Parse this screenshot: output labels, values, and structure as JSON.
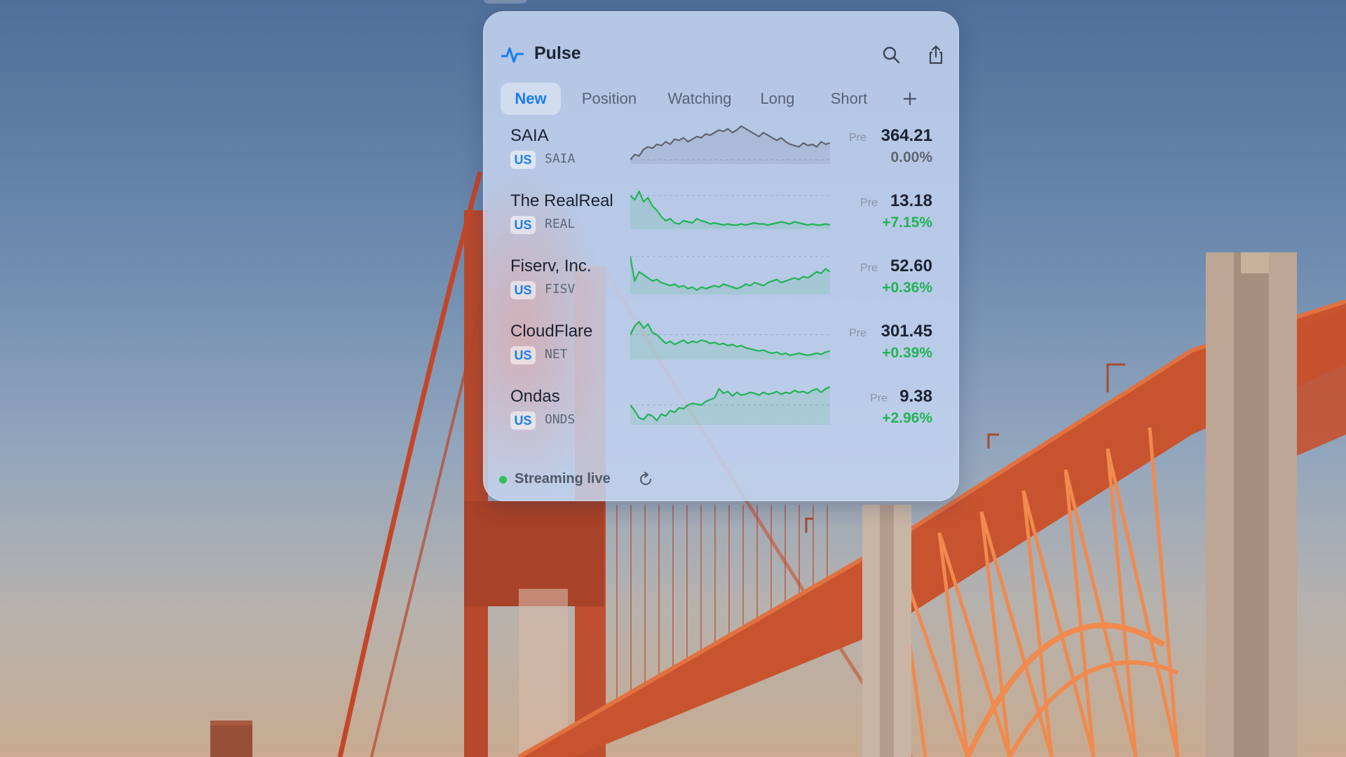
{
  "app": {
    "title": "Pulse",
    "icon": "pulse-icon"
  },
  "header": {
    "actions": [
      {
        "name": "search-icon"
      },
      {
        "name": "share-icon"
      },
      {
        "name": "more-icon"
      }
    ]
  },
  "tabs": [
    {
      "label": "New",
      "active": true
    },
    {
      "label": "Position",
      "active": false
    },
    {
      "label": "Watching",
      "active": false
    },
    {
      "label": "Long",
      "active": false
    },
    {
      "label": "Short",
      "active": false
    }
  ],
  "add_tab_icon": "plus-icon",
  "stocks": [
    {
      "name": "SAIA",
      "market": "US",
      "ticker": "SAIA",
      "session": "Pre",
      "price": "364.21",
      "change": "0.00%",
      "trend": "flat",
      "spark": [
        10,
        14,
        13,
        18,
        20,
        19,
        22,
        21,
        24,
        22,
        26,
        25,
        27,
        24,
        26,
        28,
        27,
        30,
        29,
        31,
        33,
        32,
        34,
        31,
        33,
        36,
        34,
        32,
        30,
        28,
        31,
        29,
        27,
        25,
        27,
        24,
        22,
        21,
        20,
        23,
        21,
        22,
        20,
        24,
        22,
        23
      ]
    },
    {
      "name": "The RealReal",
      "market": "US",
      "ticker": "REAL",
      "session": "Pre",
      "price": "13.18",
      "change": "+7.15%",
      "trend": "up",
      "spark": [
        30,
        26,
        34,
        24,
        28,
        20,
        16,
        10,
        6,
        8,
        4,
        3,
        6,
        5,
        4,
        8,
        6,
        5,
        3,
        4,
        3,
        2,
        3,
        2,
        2,
        3,
        2,
        3,
        4,
        3,
        3,
        2,
        3,
        4,
        5,
        4,
        3,
        5,
        4,
        3,
        2,
        3,
        2,
        2,
        3,
        2
      ]
    },
    {
      "name": "Fiserv, Inc.",
      "market": "US",
      "ticker": "FISV",
      "session": "Pre",
      "price": "52.60",
      "change": "+0.36%",
      "trend": "up",
      "spark": [
        32,
        16,
        22,
        20,
        18,
        16,
        17,
        15,
        14,
        13,
        14,
        12,
        13,
        11,
        12,
        10,
        12,
        11,
        12,
        13,
        12,
        14,
        13,
        12,
        11,
        12,
        14,
        13,
        15,
        14,
        13,
        15,
        16,
        17,
        15,
        16,
        17,
        18,
        17,
        19,
        18,
        20,
        22,
        21,
        24,
        22
      ]
    },
    {
      "name": "CloudFlare",
      "market": "US",
      "ticker": "NET",
      "session": "Pre",
      "price": "301.45",
      "change": "+0.39%",
      "trend": "up",
      "spark": [
        22,
        30,
        34,
        28,
        32,
        24,
        22,
        18,
        14,
        16,
        13,
        15,
        17,
        14,
        16,
        15,
        17,
        16,
        14,
        15,
        13,
        14,
        12,
        13,
        11,
        12,
        10,
        9,
        8,
        7,
        8,
        6,
        5,
        6,
        4,
        5,
        3,
        4,
        5,
        4,
        3,
        4,
        5,
        4,
        6,
        7
      ]
    },
    {
      "name": "Ondas",
      "market": "US",
      "ticker": "ONDS",
      "session": "Pre",
      "price": "9.38",
      "change": "+2.96%",
      "trend": "up",
      "spark": [
        20,
        14,
        6,
        4,
        10,
        8,
        3,
        10,
        8,
        14,
        12,
        17,
        16,
        20,
        22,
        21,
        20,
        24,
        26,
        28,
        38,
        33,
        35,
        30,
        34,
        31,
        32,
        34,
        33,
        31,
        34,
        32,
        33,
        35,
        32,
        34,
        33,
        36,
        34,
        35,
        33,
        36,
        38,
        34,
        38,
        40
      ]
    }
  ],
  "colors": {
    "accent": "#1b7cf0",
    "up": "#22b356",
    "flat": "#5f6470",
    "live": "#2fc25b"
  },
  "footer": {
    "status": "Streaming live",
    "refresh_icon": "refresh-icon"
  }
}
